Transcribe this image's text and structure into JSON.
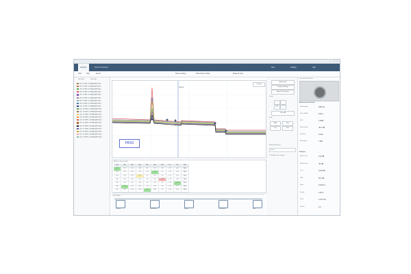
{
  "window": {
    "title": ""
  },
  "ribbon": {
    "tabs": [
      "Analysis",
      "Flash Test Report"
    ],
    "right": [
      "Files",
      "Settings",
      "Help"
    ]
  },
  "toolbar": {
    "items": [
      "Start",
      "Stop",
      "Export"
    ],
    "center": "Sweep Setting",
    "center2": "Show Filtered Data",
    "right": "Relay all ports"
  },
  "left": {
    "tabs": [
      "Test Files",
      "Port Files"
    ],
    "rows": [
      {
        "name": "DUT 1 FWR  C1 FINAL AIRP 0001",
        "color": "#9b7b52"
      },
      {
        "name": "DUT 2 FWR  C1 FINAL AIRP 0002",
        "color": "#d46a2b"
      },
      {
        "name": "DUT 3 FWR  C1 FINAL AIRP 0003",
        "color": "#59a14f"
      },
      {
        "name": "DUT 4 FWR  C1 FINAL AIRP 0004",
        "color": "#e15759"
      },
      {
        "name": "DUT 5 FWR  C1 FINAL AIRP 0005",
        "color": "#8c5db0"
      },
      {
        "name": "DUT 6 FWR  C1 FINAL AIRP 0006",
        "color": "#b07aa1"
      },
      {
        "name": "DUT 7 FWR  C1 FINAL AIRP 0007",
        "color": "#76b7b2"
      },
      {
        "name": "DUT 8 FWR  C1 FINAL AIRP 0008",
        "color": "#4e79a7"
      },
      {
        "name": "DUT 9 FWR  C1 FINAL AIRP 0009",
        "color": "#1f3c88"
      },
      {
        "name": "DUT 10 FWR C1 FINAL AIRP 0010",
        "color": "#59a14f"
      },
      {
        "name": "DUT 11 FWR C1 FINAL AIRP 0011",
        "color": "#9c755f"
      },
      {
        "name": "DUT 12 FWR C1 FINAL AIRP 0012",
        "color": "#edc948"
      },
      {
        "name": "DUT 13 FWR C1 FINAL AIRP 0013",
        "color": "#f28e2b"
      },
      {
        "name": "DUT 14 FWR C1 FINAL AIRP 0014",
        "color": "#e15759"
      },
      {
        "name": "DUT 15 FWR C1 FINAL AIRP 0015",
        "color": "#b5651d"
      },
      {
        "name": "DUT 16 FWR C1 FINAL AIRP 0016",
        "color": "#1b1b1b"
      },
      {
        "name": "DUT 17 FWR C1 FINAL AIRP 0017",
        "color": "#6b5b95"
      },
      {
        "name": "DUT 18 FWR C1 FINAL AIRP 0018",
        "color": "#c9a227"
      },
      {
        "name": "DUT 19 FWR C1 FINAL AIRP 0019",
        "color": "#ff9da7"
      },
      {
        "name": "DUT 20 FWR C1 FINAL AIRP 0020",
        "color": "#86bcb6"
      }
    ]
  },
  "plot": {
    "pass_label": "PASS",
    "marker": "Cursor",
    "legend_btn": "Overlay"
  },
  "grid": {
    "title": "All Ports Result Table",
    "rows": [
      [
        "Port",
        "Min",
        "Max",
        "Avg",
        "Res",
        "Loss",
        "Refl",
        "Len",
        "Fwr",
        "Stat"
      ],
      [
        "P01",
        "0.21",
        "0.34",
        "0.28",
        "OK",
        "0.19",
        "-52",
        "1.20",
        "0.31",
        "PASS"
      ],
      [
        "P02",
        "0.22",
        "0.35",
        "0.29",
        "OK",
        "0.20",
        "-51",
        "1.21",
        "0.30",
        "PASS"
      ],
      [
        "P03",
        "0.19",
        "0.33",
        "0.27",
        "OK",
        "0.21",
        "-53",
        "1.19",
        "0.32",
        "PASS"
      ],
      [
        "P04",
        "0.23",
        "0.36",
        "0.30",
        "OK",
        "0.22",
        "-50",
        "1.22",
        "0.29",
        "PASS"
      ],
      [
        "P05",
        "0.20",
        "0.31",
        "0.26",
        "OK",
        "0.18",
        "-54",
        "1.18",
        "0.33",
        "PASS"
      ],
      [
        "P06",
        "0.24",
        "0.37",
        "0.31",
        "OK",
        "0.23",
        "-49",
        "1.23",
        "0.28",
        "PASS"
      ],
      [
        "P07",
        "0.21",
        "0.34",
        "0.28",
        "OK",
        "0.20",
        "-52",
        "1.20",
        "0.31",
        "PASS"
      ]
    ],
    "highlights": [
      [
        1,
        0,
        "g"
      ],
      [
        2,
        5,
        "g"
      ],
      [
        3,
        3,
        "y"
      ],
      [
        4,
        6,
        "r"
      ],
      [
        5,
        8,
        "g"
      ],
      [
        6,
        1,
        "g"
      ],
      [
        7,
        4,
        "g"
      ]
    ]
  },
  "timeline": {
    "label": "Event Map",
    "events": [
      "Launch",
      "Connector",
      "Splice",
      "Connector",
      "End"
    ]
  },
  "rp1": {
    "buttons": [
      "Automatch",
      "Display Settings",
      "Match Parameters",
      "Clear All",
      "Add",
      "Edit",
      "Del",
      "Ref"
    ],
    "zoom_label": "Zoom",
    "filter_label": "Filter",
    "select_label": "Select Reference",
    "select_value": "Port 1",
    "checkbox_label": "Enable auto analysis"
  },
  "rp2": {
    "header": "Connector End Face",
    "section1": "Measurement Results",
    "items1": [
      {
        "label": "Wavelength",
        "value": "1550 nm"
      },
      {
        "label": "Pulse Width",
        "value": "100 ns"
      },
      {
        "label": "IOR",
        "value": "1.4682"
      },
      {
        "label": "Backscatter",
        "value": "-81.6 dB"
      },
      {
        "label": "Distance",
        "value": "0.8 km"
      },
      {
        "label": "Averaging",
        "value": "1.000"
      }
    ],
    "section2": "Analysis",
    "items2": [
      {
        "label": "Splice Loss",
        "value": "0.16 dB"
      },
      {
        "label": "Reflectance",
        "value": "-52 dB"
      },
      {
        "label": "Loss",
        "value": "0.276 dB"
      },
      {
        "label": "ORL",
        "value": "45.1 dB"
      },
      {
        "label": "Span",
        "value": "0.276 km"
      },
      {
        "label": "Length",
        "value": "4.93 m"
      },
      {
        "label": "Total",
        "value": "1.3177 km"
      },
      {
        "label": "Events",
        "value": "4.0"
      }
    ]
  }
}
